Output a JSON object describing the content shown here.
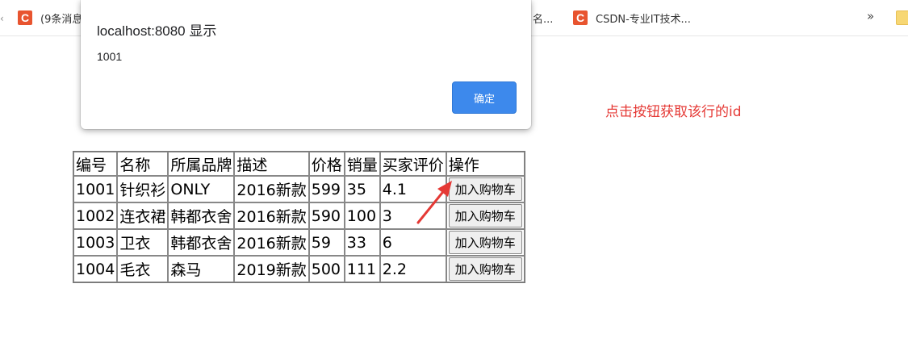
{
  "bookmarks": {
    "items": [
      {
        "icon": "csdn-logo-icon",
        "label": "(9条消息"
      },
      {
        "icon": "text-fragment",
        "label": "名..."
      },
      {
        "icon": "csdn-logo-icon",
        "label": "CSDN-专业IT技术..."
      }
    ],
    "more": "»",
    "logo_letter": "C"
  },
  "dialog": {
    "title": "localhost:8080 显示",
    "message": "1001",
    "ok_label": "确定"
  },
  "annotation": {
    "text": "点击按钮获取该行的id",
    "color": "#e53935"
  },
  "table": {
    "headers": [
      "编号",
      "名称",
      "所属品牌",
      "描述",
      "价格",
      "销量",
      "买家评价",
      "操作"
    ],
    "rows": [
      {
        "id": "1001",
        "name": "针织衫",
        "brand": "ONLY",
        "desc": "2016新款",
        "price": "599",
        "sales": "35",
        "rating": "4.1"
      },
      {
        "id": "1002",
        "name": "连衣裙",
        "brand": "韩都衣舍",
        "desc": "2016新款",
        "price": "590",
        "sales": "100",
        "rating": "3"
      },
      {
        "id": "1003",
        "name": "卫衣",
        "brand": "韩都衣舍",
        "desc": "2016新款",
        "price": "59",
        "sales": "33",
        "rating": "6"
      },
      {
        "id": "1004",
        "name": "毛衣",
        "brand": "森马",
        "desc": "2019新款",
        "price": "500",
        "sales": "111",
        "rating": "2.2"
      }
    ],
    "action_label": "加入购物车"
  },
  "colors": {
    "dialog_button": "#3d89ec",
    "csdn_brand": "#e8542f",
    "arrow": "#e53935"
  }
}
